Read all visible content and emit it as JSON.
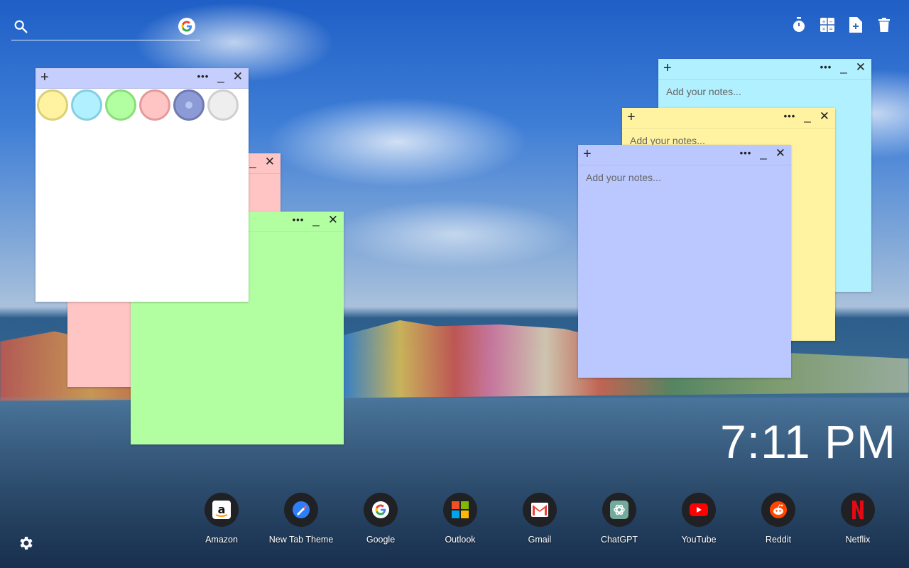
{
  "search": {
    "placeholder": "",
    "value": "",
    "engine_icon": "google-icon"
  },
  "tools": [
    {
      "name": "timer-icon"
    },
    {
      "name": "calculator-icon"
    },
    {
      "name": "add-note-icon"
    },
    {
      "name": "trash-icon"
    }
  ],
  "notes": {
    "add_glyph": "+",
    "menu_glyph": "•••",
    "minimize_glyph": "_",
    "close_glyph": "✕",
    "placeholder": "Add your notes...",
    "colors": {
      "white": "#ffffff",
      "pink": "#ffc5c5",
      "green": "#b2ffa2",
      "cyan": "#b0f0ff",
      "yellow": "#fff3a2",
      "periwinkle": "#bac8ff"
    }
  },
  "palette": [
    {
      "name": "yellow",
      "fill": "#fff3a2",
      "ring": "#dcd075"
    },
    {
      "name": "cyan",
      "fill": "#b0f0ff",
      "ring": "#85cfe0"
    },
    {
      "name": "green",
      "fill": "#b2ffa2",
      "ring": "#8bdd7a"
    },
    {
      "name": "pink",
      "fill": "#ffc5c5",
      "ring": "#e59a9a"
    },
    {
      "name": "periwinkle",
      "fill": "#8c9bd6",
      "ring": "#6e7ab0",
      "selected": true
    },
    {
      "name": "light-gray",
      "fill": "#eeeeee",
      "ring": "#cfcfcf"
    }
  ],
  "clock": {
    "time": "7:11 PM"
  },
  "dock": [
    {
      "label": "Amazon",
      "icon": "amazon-icon"
    },
    {
      "label": "New Tab Theme",
      "icon": "new-tab-theme-icon"
    },
    {
      "label": "Google",
      "icon": "google-icon"
    },
    {
      "label": "Outlook",
      "icon": "outlook-icon"
    },
    {
      "label": "Gmail",
      "icon": "gmail-icon"
    },
    {
      "label": "ChatGPT",
      "icon": "chatgpt-icon"
    },
    {
      "label": "YouTube",
      "icon": "youtube-icon"
    },
    {
      "label": "Reddit",
      "icon": "reddit-icon"
    },
    {
      "label": "Netflix",
      "icon": "netflix-icon"
    }
  ],
  "settings_icon": "gear-icon"
}
